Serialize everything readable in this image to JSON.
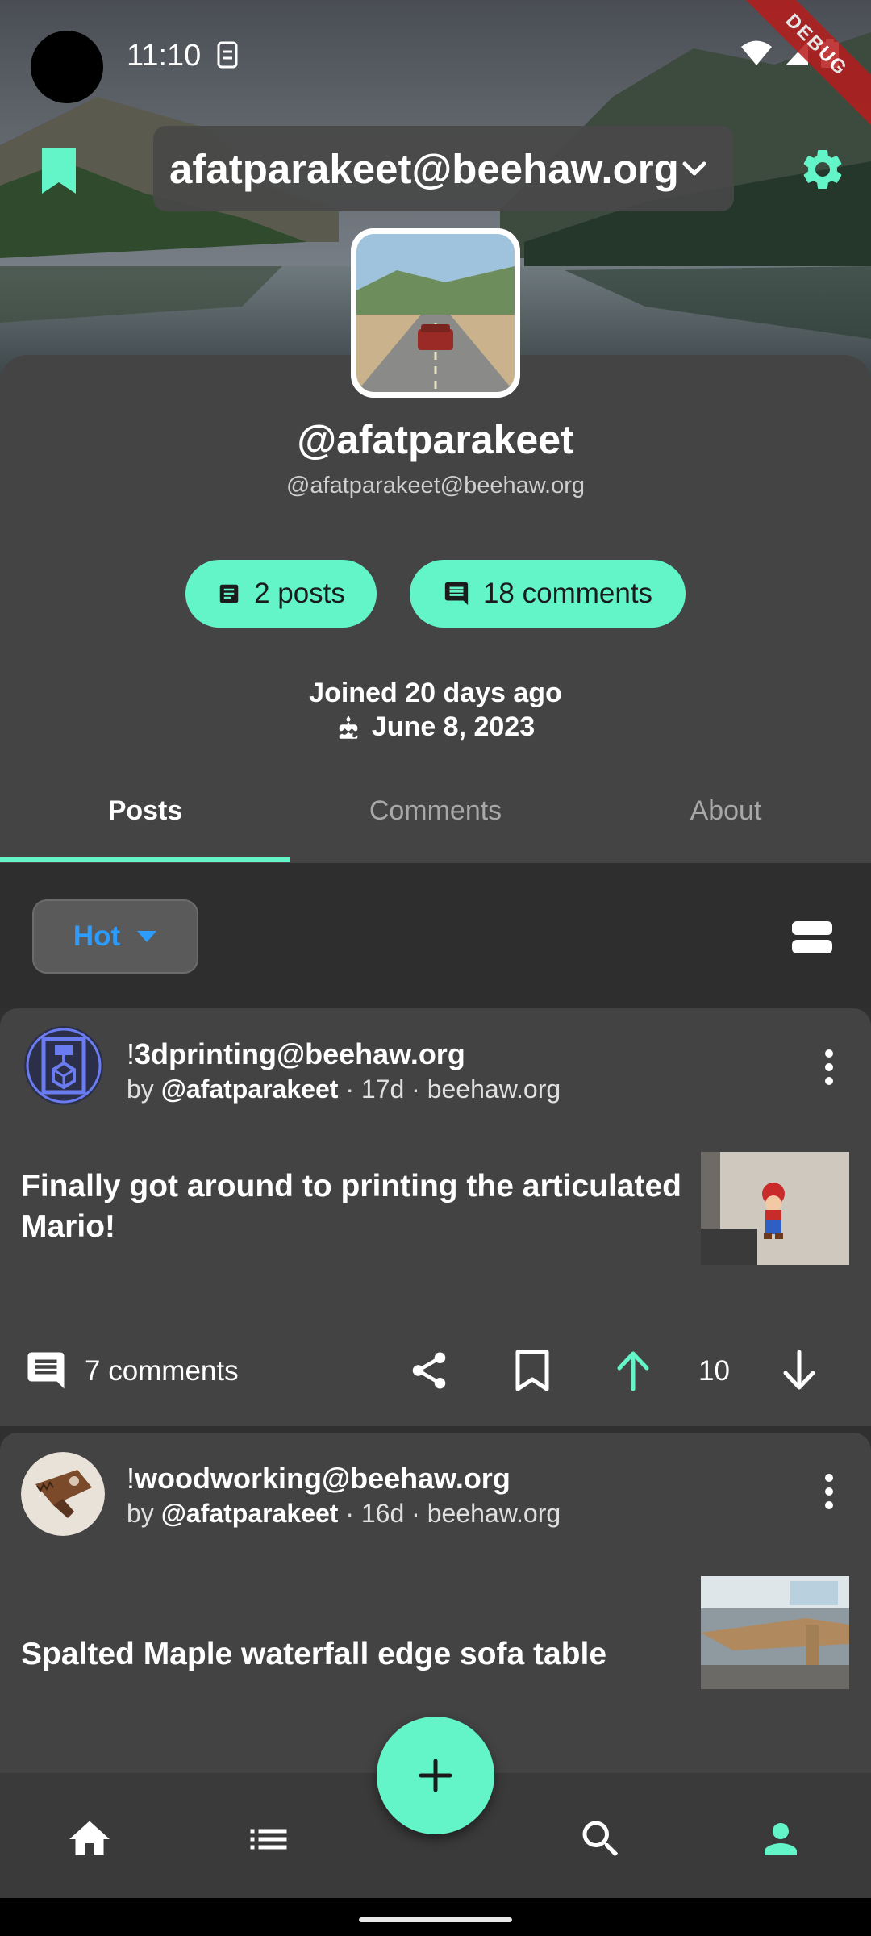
{
  "status_bar": {
    "time": "11:10",
    "debug_label": "DEBUG"
  },
  "app_bar": {
    "account": "afatparakeet@beehaw.org"
  },
  "profile": {
    "username": "@afatparakeet",
    "handle": "@afatparakeet@beehaw.org",
    "posts_chip": "2 posts",
    "comments_chip": "18 comments",
    "joined": "Joined 20 days ago",
    "birthday": "June 8, 2023"
  },
  "tabs": [
    {
      "label": "Posts",
      "active": true
    },
    {
      "label": "Comments",
      "active": false
    },
    {
      "label": "About",
      "active": false
    }
  ],
  "sort": {
    "label": "Hot"
  },
  "posts": [
    {
      "community_prefix": "!",
      "community": "3dprinting",
      "community_instance": "@beehaw.org",
      "by": "by ",
      "author": "@afatparakeet",
      "meta_suffix": " · 17d · beehaw.org",
      "title": "Finally got around to printing the articulated Mario!",
      "comments": "7 comments",
      "score": "10"
    },
    {
      "community_prefix": "!",
      "community": "woodworking",
      "community_instance": "@beehaw.org",
      "by": "by ",
      "author": "@afatparakeet",
      "meta_suffix": " · 16d · beehaw.org",
      "title": "Spalted Maple waterfall edge sofa table"
    }
  ],
  "colors": {
    "accent": "#63f5c8",
    "sort_text": "#2d9cff",
    "background": "#303030",
    "card": "#434343"
  },
  "icons": {
    "bottom_nav": [
      "home-icon",
      "list-icon",
      "search-icon",
      "person-icon"
    ],
    "fab": "plus-icon"
  }
}
